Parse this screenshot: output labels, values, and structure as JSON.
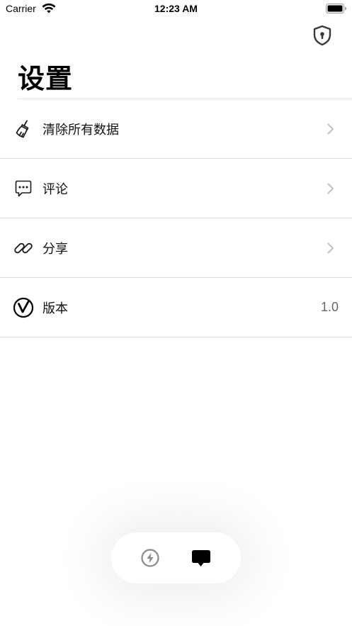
{
  "status_bar": {
    "carrier": "Carrier",
    "time": "12:23 AM"
  },
  "header": {
    "title": "设置",
    "action_icon": "shield-keyhole-icon"
  },
  "settings": {
    "items": [
      {
        "label": "清除所有数据",
        "icon": "broom-icon",
        "accessory": "chevron"
      },
      {
        "label": "评论",
        "icon": "chat-bubble-dots-icon",
        "accessory": "chevron"
      },
      {
        "label": "分享",
        "icon": "link-icon",
        "accessory": "chevron"
      },
      {
        "label": "版本",
        "icon": "v-circle-icon",
        "value": "1.0"
      }
    ]
  },
  "tab_bar": {
    "items": [
      {
        "icon": "lightning-circle-icon",
        "selected": false
      },
      {
        "icon": "chat-bubble-icon",
        "selected": true
      }
    ]
  },
  "colors": {
    "chevron": "#c4c4c7",
    "divider": "#dedee0",
    "tab_inactive": "#8a8a8e",
    "tab_active": "#000000"
  }
}
